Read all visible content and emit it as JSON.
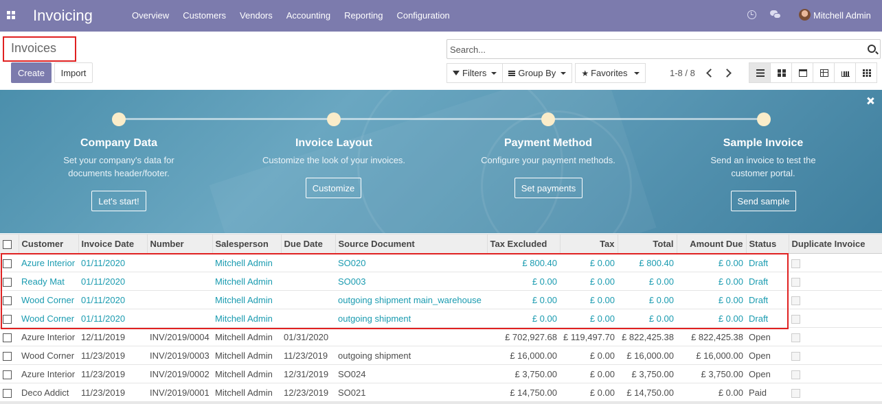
{
  "app": {
    "title": "Invoicing",
    "menu": [
      "Overview",
      "Customers",
      "Vendors",
      "Accounting",
      "Reporting",
      "Configuration"
    ],
    "user_name": "Mitchell Admin"
  },
  "control_panel": {
    "breadcrumb": "Invoices",
    "create_label": "Create",
    "import_label": "Import",
    "search_placeholder": "Search...",
    "filters_label": "Filters",
    "group_by_label": "Group By",
    "favorites_label": "Favorites",
    "pager": "1-8 / 8"
  },
  "banner": {
    "steps": [
      {
        "title": "Company Data",
        "desc1": "Set your company's data for",
        "desc2": "documents header/footer.",
        "button": "Let's start!"
      },
      {
        "title": "Invoice Layout",
        "desc1": "Customize the look of your invoices.",
        "desc2": "",
        "button": "Customize"
      },
      {
        "title": "Payment Method",
        "desc1": "Configure your payment methods.",
        "desc2": "",
        "button": "Set payments"
      },
      {
        "title": "Sample Invoice",
        "desc1": "Send an invoice to test the",
        "desc2": "customer portal.",
        "button": "Send sample"
      }
    ]
  },
  "table": {
    "columns": [
      "Customer",
      "Invoice Date",
      "Number",
      "Salesperson",
      "Due Date",
      "Source Document",
      "Tax Excluded",
      "Tax",
      "Total",
      "Amount Due",
      "Status",
      "Duplicate Invoice"
    ],
    "rows": [
      {
        "customer": "Azure Interior",
        "invoice_date": "01/11/2020",
        "number": "",
        "salesperson": "Mitchell Admin",
        "due_date": "",
        "source": "SO020",
        "tax_excluded": "£ 800.40",
        "tax": "£ 0.00",
        "total": "£ 800.40",
        "amount_due": "£ 0.00",
        "status": "Draft"
      },
      {
        "customer": "Ready Mat",
        "invoice_date": "01/11/2020",
        "number": "",
        "salesperson": "Mitchell Admin",
        "due_date": "",
        "source": "SO003",
        "tax_excluded": "£ 0.00",
        "tax": "£ 0.00",
        "total": "£ 0.00",
        "amount_due": "£ 0.00",
        "status": "Draft"
      },
      {
        "customer": "Wood Corner",
        "invoice_date": "01/11/2020",
        "number": "",
        "salesperson": "Mitchell Admin",
        "due_date": "",
        "source": "outgoing shipment main_warehouse",
        "tax_excluded": "£ 0.00",
        "tax": "£ 0.00",
        "total": "£ 0.00",
        "amount_due": "£ 0.00",
        "status": "Draft"
      },
      {
        "customer": "Wood Corner",
        "invoice_date": "01/11/2020",
        "number": "",
        "salesperson": "Mitchell Admin",
        "due_date": "",
        "source": "outgoing shipment",
        "tax_excluded": "£ 0.00",
        "tax": "£ 0.00",
        "total": "£ 0.00",
        "amount_due": "£ 0.00",
        "status": "Draft"
      },
      {
        "customer": "Azure Interior",
        "invoice_date": "12/11/2019",
        "number": "INV/2019/0004",
        "salesperson": "Mitchell Admin",
        "due_date": "01/31/2020",
        "source": "",
        "tax_excluded": "£ 702,927.68",
        "tax": "£ 119,497.70",
        "total": "£ 822,425.38",
        "amount_due": "£ 822,425.38",
        "status": "Open"
      },
      {
        "customer": "Wood Corner",
        "invoice_date": "11/23/2019",
        "number": "INV/2019/0003",
        "salesperson": "Mitchell Admin",
        "due_date": "11/23/2019",
        "source": "outgoing shipment",
        "tax_excluded": "£ 16,000.00",
        "tax": "£ 0.00",
        "total": "£ 16,000.00",
        "amount_due": "£ 16,000.00",
        "status": "Open"
      },
      {
        "customer": "Azure Interior",
        "invoice_date": "11/23/2019",
        "number": "INV/2019/0002",
        "salesperson": "Mitchell Admin",
        "due_date": "12/31/2019",
        "source": "SO024",
        "tax_excluded": "£ 3,750.00",
        "tax": "£ 0.00",
        "total": "£ 3,750.00",
        "amount_due": "£ 3,750.00",
        "status": "Open"
      },
      {
        "customer": "Deco Addict",
        "invoice_date": "11/23/2019",
        "number": "INV/2019/0001",
        "salesperson": "Mitchell Admin",
        "due_date": "12/23/2019",
        "source": "SO021",
        "tax_excluded": "£ 14,750.00",
        "tax": "£ 0.00",
        "total": "£ 14,750.00",
        "amount_due": "£ 0.00",
        "status": "Paid"
      }
    ]
  },
  "colors": {
    "navbar": "#7c7bad",
    "draft_text": "#1a9bb0",
    "highlight": "#e02020",
    "banner": "#5896b3"
  },
  "icons": [
    "apps-icon",
    "clock-icon",
    "chat-icon",
    "search-icon",
    "filter-icon",
    "group-by-icon",
    "star-icon",
    "list-view-icon",
    "kanban-view-icon",
    "calendar-view-icon",
    "pivot-view-icon",
    "graph-view-icon",
    "dashboard-view-icon",
    "close-icon"
  ]
}
